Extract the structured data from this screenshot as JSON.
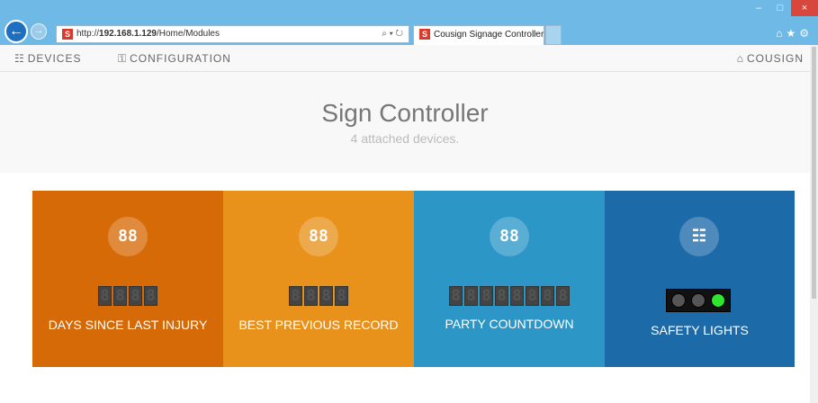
{
  "browser": {
    "url_prefix": "http://",
    "url_host": "192.168.1.129",
    "url_path": "/Home/Modules",
    "addr_icons": "⌕ ▾ ↻",
    "tab_title": "Cousign Signage Controller",
    "tab_close": "×",
    "favicon": "S"
  },
  "appnav": {
    "devices_label": "DEVICES",
    "configuration_label": "CONFIGURATION",
    "brand_label": "COUSIGN"
  },
  "page": {
    "title": "Sign Controller",
    "subtitle": "4 attached devices."
  },
  "tiles": [
    {
      "icon": "88",
      "digits": [
        "8",
        "8",
        "8",
        "8"
      ],
      "lit": [
        false,
        false,
        false,
        false
      ],
      "label": "DAYS SINCE LAST INJURY",
      "color": "#d66a06"
    },
    {
      "icon": "88",
      "digits": [
        "8",
        "8",
        "8",
        "8"
      ],
      "lit": [
        false,
        false,
        false,
        false
      ],
      "label": "BEST PREVIOUS RECORD",
      "color": "#e8921c"
    },
    {
      "icon": "88",
      "digits": [
        "8",
        "8",
        "8",
        "8",
        "8",
        "8",
        "8",
        "8"
      ],
      "lit": [
        false,
        false,
        false,
        false,
        false,
        false,
        false,
        false
      ],
      "label": "PARTY COUNTDOWN",
      "color": "#2c97c7"
    },
    {
      "icon": "traffic-light",
      "label": "SAFETY LIGHTS",
      "color": "#1d6aa8",
      "lights": {
        "red": false,
        "yellow": false,
        "green": true
      }
    }
  ]
}
